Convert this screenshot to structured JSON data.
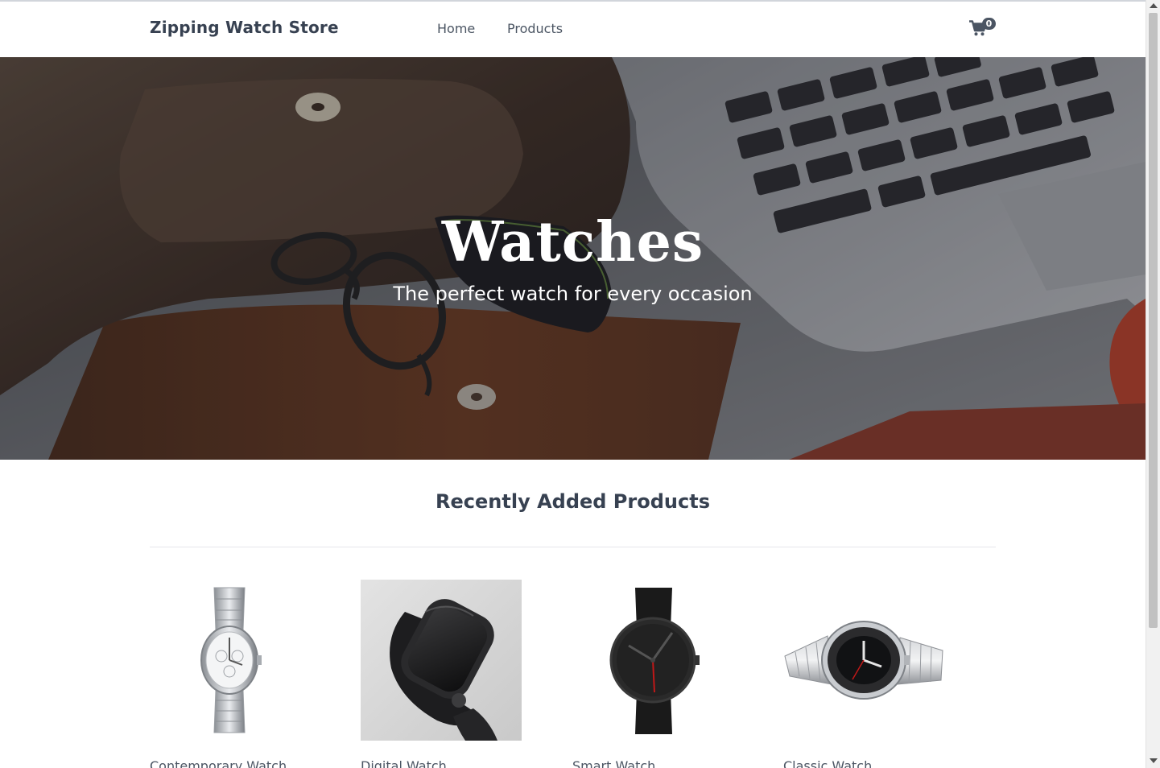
{
  "header": {
    "brand": "Zipping Watch Store",
    "nav": [
      {
        "label": "Home"
      },
      {
        "label": "Products"
      }
    ],
    "cart": {
      "icon": "shopping-cart-icon",
      "count": "0"
    }
  },
  "hero": {
    "title": "Watches",
    "subtitle": "The perfect watch for every occasion"
  },
  "section": {
    "title": "Recently Added Products"
  },
  "products": [
    {
      "name": "Contemporary Watch",
      "image": "silver-chronograph-watch"
    },
    {
      "name": "Digital Watch",
      "image": "black-smartwatch"
    },
    {
      "name": "Smart Watch",
      "image": "black-leather-strap-watch"
    },
    {
      "name": "Classic Watch",
      "image": "steel-diver-watch"
    }
  ],
  "colors": {
    "text": "#374151",
    "badge": "#4b5563",
    "divider": "#e5e7eb"
  }
}
